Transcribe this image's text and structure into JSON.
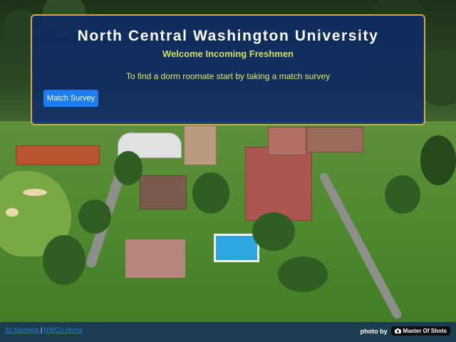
{
  "hero": {
    "title": "North Central Washington University",
    "subtitle": "Welcome Incoming Freshmen",
    "text": "To find a dorm roomate start by taking a match survey",
    "button_label": "Match Survey"
  },
  "footer": {
    "links": [
      "All Students",
      "NWCU Home"
    ],
    "separator": "|",
    "credit_prefix": "photo by",
    "credit_name": "Master Of Shots"
  },
  "colors": {
    "hero_background": "#0a286e",
    "hero_border": "#d9a64c",
    "subtitle": "#d4e063",
    "button": "#1e7df2",
    "link": "#2a7ae8"
  },
  "icons": {
    "credit_badge": "camera-icon"
  }
}
